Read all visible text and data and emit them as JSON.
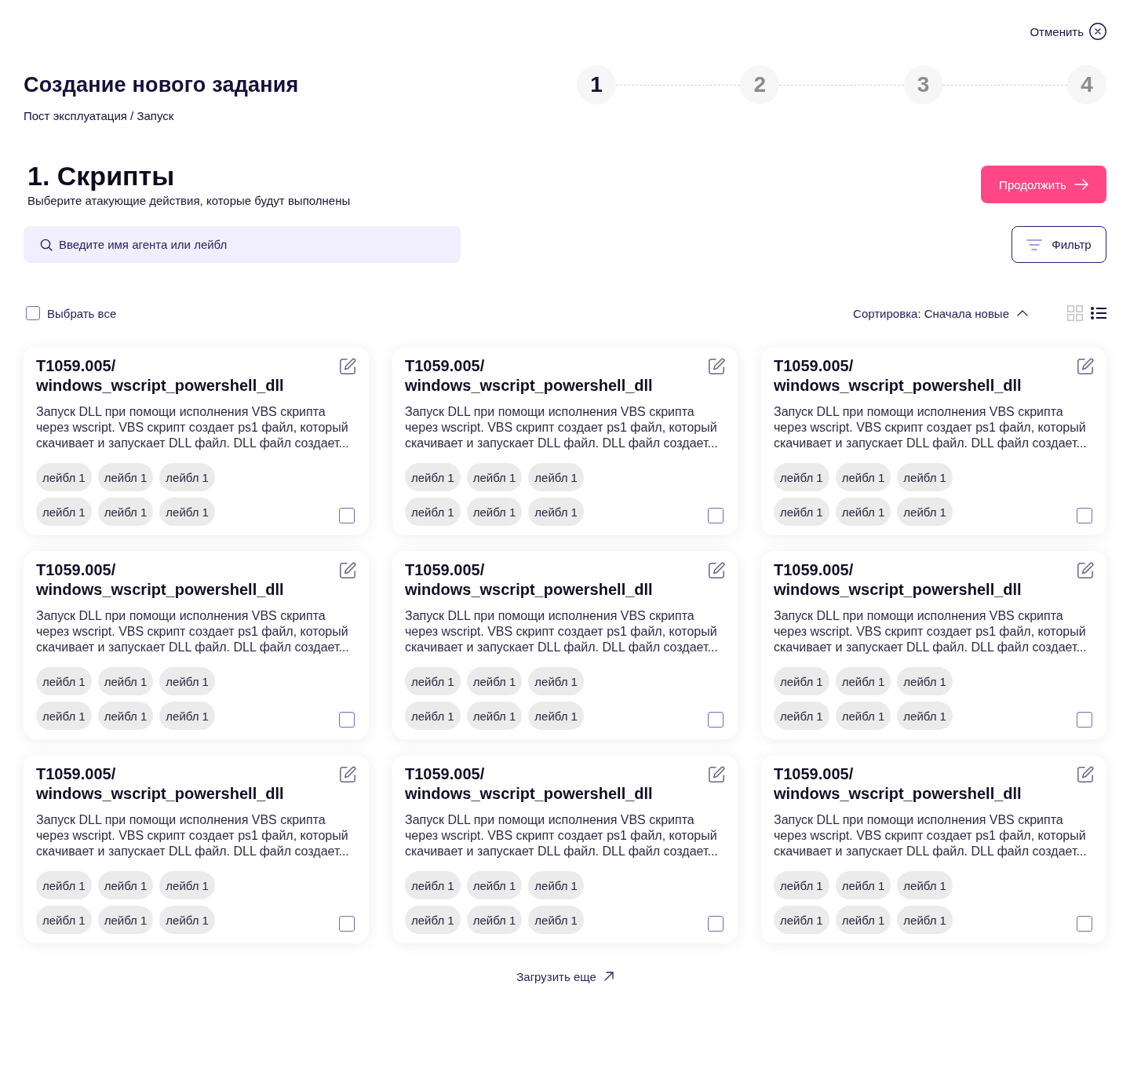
{
  "header": {
    "cancel": "Отменить",
    "title": "Создание нового задания",
    "breadcrumb": "Пост эксплуатация / Запуск"
  },
  "steps": [
    {
      "label": "1",
      "selected": true
    },
    {
      "label": "2",
      "selected": false
    },
    {
      "label": "3",
      "selected": false
    },
    {
      "label": "4",
      "selected": false
    }
  ],
  "section": {
    "title": "1. Скрипты",
    "subtitle": "Выберите атакующие действия, которые будут выполнены",
    "continue": "Продолжить"
  },
  "search": {
    "placeholder": "Введите имя агента или лейбл"
  },
  "filter": {
    "label": "Фильтр"
  },
  "toolbar": {
    "select_all": {
      "label": "Выбрать все",
      "checked": false
    },
    "sort": "Сортировка: Сначала новые",
    "view_modes": [
      {
        "kind": "grid",
        "selected": false
      },
      {
        "kind": "list",
        "selected": true
      }
    ]
  },
  "cards": [
    {
      "id": "T1059.005/",
      "name": "windows_wscript_powershell_dll",
      "description": "Запуск DLL при помощи исполнения VBS скрипта через wscript. VBS скрипт создает ps1 файл, который скачивает и запускает DLL файл. DLL файл создает...",
      "labels": [
        "лейбл 1",
        "лейбл 1",
        "лейбл 1",
        "лейбл 1",
        "лейбл 1",
        "лейбл 1"
      ],
      "checked": false
    },
    {
      "id": "T1059.005/",
      "name": "windows_wscript_powershell_dll",
      "description": "Запуск DLL при помощи исполнения VBS скрипта через wscript. VBS скрипт создает ps1 файл, который скачивает и запускает DLL файл. DLL файл создает...",
      "labels": [
        "лейбл 1",
        "лейбл 1",
        "лейбл 1",
        "лейбл 1",
        "лейбл 1",
        "лейбл 1"
      ],
      "checked": false
    },
    {
      "id": "T1059.005/",
      "name": "windows_wscript_powershell_dll",
      "description": "Запуск DLL при помощи исполнения VBS скрипта через wscript. VBS скрипт создает ps1 файл, который скачивает и запускает DLL файл. DLL файл создает...",
      "labels": [
        "лейбл 1",
        "лейбл 1",
        "лейбл 1",
        "лейбл 1",
        "лейбл 1",
        "лейбл 1"
      ],
      "checked": false
    },
    {
      "id": "T1059.005/",
      "name": "windows_wscript_powershell_dll",
      "description": "Запуск DLL при помощи исполнения VBS скрипта через wscript. VBS скрипт создает ps1 файл, который скачивает и запускает DLL файл. DLL файл создает...",
      "labels": [
        "лейбл 1",
        "лейбл 1",
        "лейбл 1",
        "лейбл 1",
        "лейбл 1",
        "лейбл 1"
      ],
      "checked": false
    },
    {
      "id": "T1059.005/",
      "name": "windows_wscript_powershell_dll",
      "description": "Запуск DLL при помощи исполнения VBS скрипта через wscript. VBS скрипт создает ps1 файл, который скачивает и запускает DLL файл. DLL файл создает...",
      "labels": [
        "лейбл 1",
        "лейбл 1",
        "лейбл 1",
        "лейбл 1",
        "лейбл 1",
        "лейбл 1"
      ],
      "checked": false
    },
    {
      "id": "T1059.005/",
      "name": "windows_wscript_powershell_dll",
      "description": "Запуск DLL при помощи исполнения VBS скрипта через wscript. VBS скрипт создает ps1 файл, который скачивает и запускает DLL файл. DLL файл создает...",
      "labels": [
        "лейбл 1",
        "лейбл 1",
        "лейбл 1",
        "лейбл 1",
        "лейбл 1",
        "лейбл 1"
      ],
      "checked": false
    },
    {
      "id": "T1059.005/",
      "name": "windows_wscript_powershell_dll",
      "description": "Запуск DLL при помощи исполнения VBS скрипта через wscript. VBS скрипт создает ps1 файл, который скачивает и запускает DLL файл. DLL файл создает...",
      "labels": [
        "лейбл 1",
        "лейбл 1",
        "лейбл 1",
        "лейбл 1",
        "лейбл 1",
        "лейбл 1"
      ],
      "checked": false
    },
    {
      "id": "T1059.005/",
      "name": "windows_wscript_powershell_dll",
      "description": "Запуск DLL при помощи исполнения VBS скрипта через wscript. VBS скрипт создает ps1 файл, который скачивает и запускает DLL файл. DLL файл создает...",
      "labels": [
        "лейбл 1",
        "лейбл 1",
        "лейбл 1",
        "лейбл 1",
        "лейбл 1",
        "лейбл 1"
      ],
      "checked": false
    },
    {
      "id": "T1059.005/",
      "name": "windows_wscript_powershell_dll",
      "description": "Запуск DLL при помощи исполнения VBS скрипта через wscript. VBS скрипт создает ps1 файл, который скачивает и запускает DLL файл. DLL файл создает...",
      "labels": [
        "лейбл 1",
        "лейбл 1",
        "лейбл 1",
        "лейбл 1",
        "лейбл 1",
        "лейбл 1"
      ],
      "checked": false
    }
  ],
  "load_more": "Загрузить еще"
}
